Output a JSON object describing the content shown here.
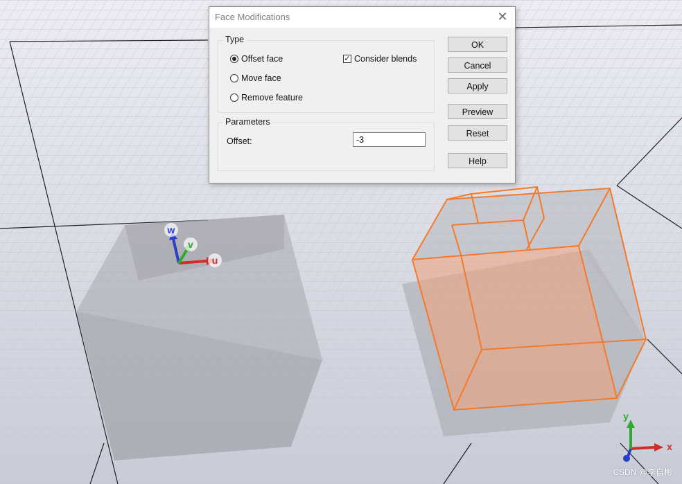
{
  "dialog": {
    "title": "Face Modifications",
    "close_glyph": "✕",
    "type_group": {
      "legend": "Type",
      "options": [
        {
          "label": "Offset face",
          "checked": true
        },
        {
          "label": "Move face",
          "checked": false
        },
        {
          "label": "Remove feature",
          "checked": false
        }
      ],
      "consider_blends": {
        "label": "Consider blends",
        "checked": true
      }
    },
    "parameters_group": {
      "legend": "Parameters",
      "offset_label": "Offset:",
      "offset_value": "-3"
    },
    "buttons": {
      "ok": "OK",
      "cancel": "Cancel",
      "apply": "Apply",
      "preview": "Preview",
      "reset": "Reset",
      "help": "Help"
    }
  },
  "viewport": {
    "local_axes": {
      "u": "u",
      "v": "v",
      "w": "w"
    },
    "global_axes": {
      "x": "x",
      "y": "y"
    },
    "colors": {
      "grid": "#b8bcc8",
      "highlight": "#f47a2a",
      "axis_x": "#d22b2b",
      "axis_y": "#2faa2f",
      "axis_z": "#2b3fc8"
    }
  },
  "watermark": "CSDN @李自彬"
}
